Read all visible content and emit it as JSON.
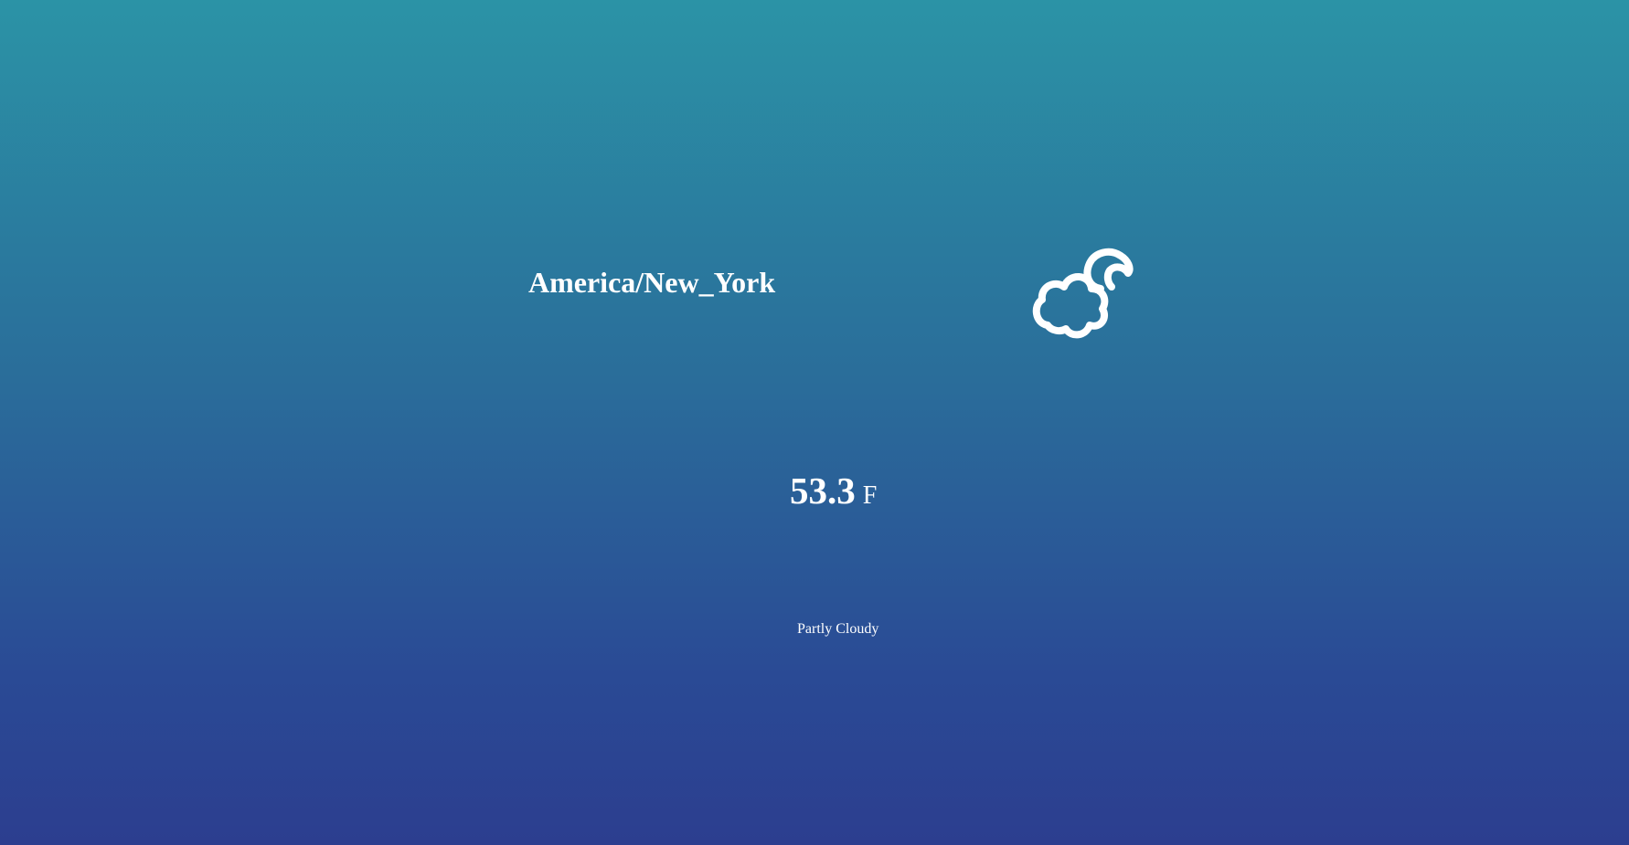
{
  "location": {
    "timezone": "America/New_York"
  },
  "weather": {
    "icon": "partly-cloudy-night-icon",
    "temperature": "53.3",
    "unit": "F",
    "summary": "Partly Cloudy"
  },
  "colors": {
    "gradient_top": "#2b93a6",
    "gradient_bottom": "#2c3e8f",
    "text": "#ffffff"
  }
}
